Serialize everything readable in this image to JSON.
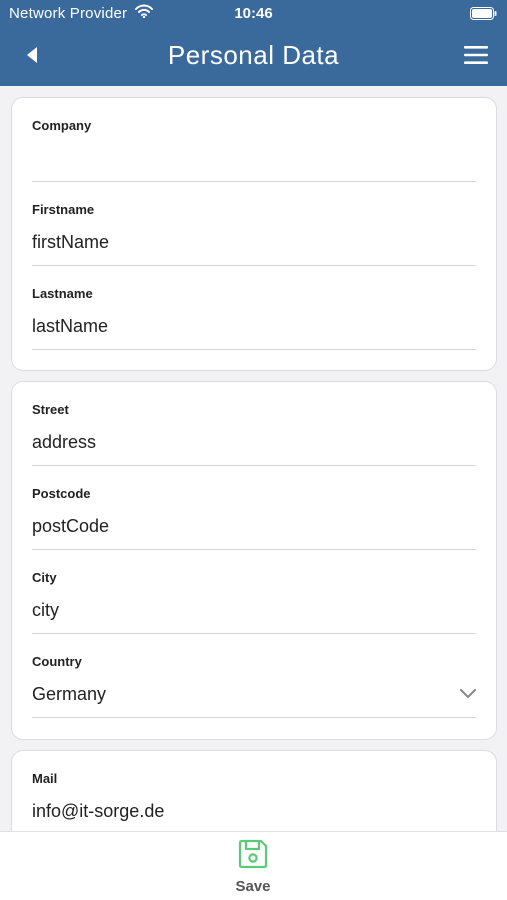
{
  "status_bar": {
    "carrier": "Network Provider",
    "time": "10:46"
  },
  "nav": {
    "title": "Personal Data",
    "back_icon": "back-arrow-icon",
    "menu_icon": "hamburger-menu-icon"
  },
  "cards": {
    "company": {
      "label": "Company",
      "value": "",
      "firstname_label": "Firstname",
      "firstname_value": "firstName",
      "lastname_label": "Lastname",
      "lastname_value": "lastName"
    },
    "address": {
      "street_label": "Street",
      "street_value": "address",
      "postcode_label": "Postcode",
      "postcode_value": "postCode",
      "city_label": "City",
      "city_value": "city",
      "country_label": "Country",
      "country_value": "Germany"
    },
    "contact": {
      "mail_label": "Mail",
      "mail_value": "info@it-sorge.de"
    }
  },
  "bottom_bar": {
    "save_label": "Save",
    "save_icon": "floppy-disk-icon"
  },
  "colors": {
    "header": "#3a6a9c",
    "save_icon": "#5cc87a"
  }
}
